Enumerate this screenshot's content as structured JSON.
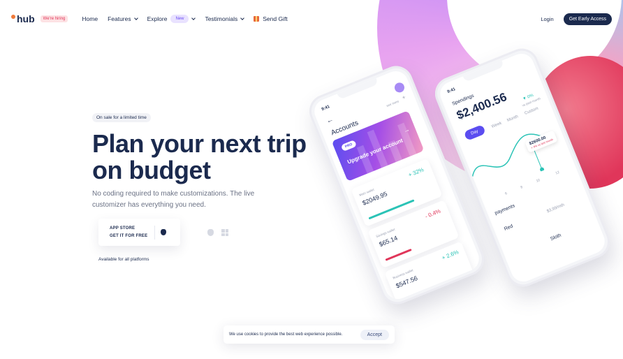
{
  "colors": {
    "primary": "#1b2a4e",
    "accent": "#6b4df3",
    "positive": "#2bc3b6",
    "negative": "#e0365a",
    "brand_dot": "#f07a3a"
  },
  "nav": {
    "logo": "hub",
    "hiring_badge": "We're hiring",
    "items": [
      {
        "label": "Home",
        "has_dropdown": false
      },
      {
        "label": "Features",
        "has_dropdown": true
      },
      {
        "label": "Explore",
        "badge": "New",
        "has_dropdown": true
      },
      {
        "label": "Testimonials",
        "has_dropdown": true
      }
    ],
    "gift": {
      "label": "Send Gift",
      "icon": "gift-icon"
    },
    "login": "Login",
    "cta": "Get Early Access"
  },
  "hero": {
    "sale_badge": "On sale for a limited time",
    "headline_line1": "Plan your next trip",
    "headline_line2_prefix": "on ",
    "headline_highlight": "budget",
    "subtitle": "No coding required to make customizations. The live customizer has everything you need.",
    "store": {
      "line1": "APP STORE",
      "line2": "GET IT FOR FREE",
      "icon": "apple-icon"
    },
    "platform_icons": [
      "apple-icon",
      "windows-icon"
    ],
    "platforms_note": "Available for all platforms"
  },
  "phone_front": {
    "time": "9:41",
    "title": "Accounts",
    "see_more": "see more",
    "promo": {
      "badge": "PRO",
      "text": "Upgrade your account"
    },
    "accounts": [
      {
        "name": "Main wallet",
        "amount": "$2049.95",
        "change": "+ 32%",
        "trend": "up"
      },
      {
        "name": "Savings wallet",
        "amount": "$65.14",
        "change": "- 0.4%",
        "trend": "down"
      },
      {
        "name": "Business wallet",
        "amount": "$547.56",
        "change": "+ 2.6%",
        "trend": "up"
      }
    ]
  },
  "phone_back": {
    "time": "9:41",
    "title": "Spendings",
    "amount": "$2,400.56",
    "change": "▼ 0%",
    "change_note": "vs past month",
    "periods": [
      "Day",
      "Week",
      "Month",
      "Custom"
    ],
    "tooltip_amount": "$2600.00",
    "tooltip_change": "+ 4% vs last month",
    "axis": [
      "6",
      "8",
      "10",
      "12"
    ],
    "section": "payments",
    "row_label": "Red",
    "row_amount": "$3,99/mth",
    "row2": "Sloth"
  },
  "cookie": {
    "text": "We use cookies to provide the best web experience possible.",
    "accept": "Accept"
  }
}
